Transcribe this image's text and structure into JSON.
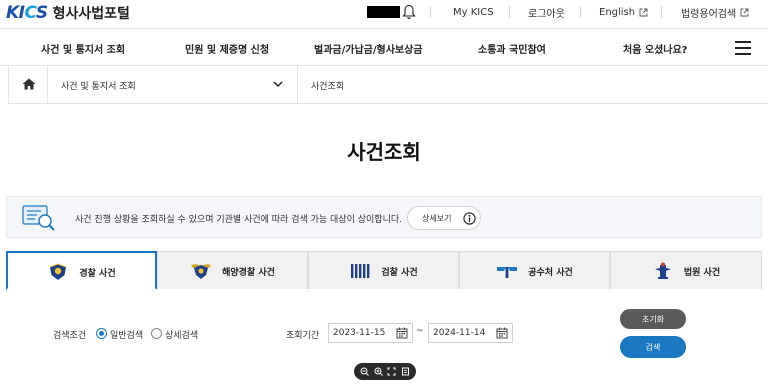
{
  "header": {
    "logo_text": "KICS",
    "site_title": "형사사법포털",
    "utility": [
      {
        "label": "My KICS"
      },
      {
        "label": "로그아웃"
      },
      {
        "label": "English"
      },
      {
        "label": "법령용어검색"
      }
    ]
  },
  "nav": {
    "items": [
      {
        "label": "사건 및 통지서 조회"
      },
      {
        "label": "민원 및 제증명 신청"
      },
      {
        "label": "벌과금/가납금/형사보상금"
      },
      {
        "label": "소통과 국민참여"
      },
      {
        "label": "처음 오셨나요?"
      }
    ],
    "menu_icon": "hamburger-icon"
  },
  "breadcrumb": {
    "home_icon": "home-icon",
    "level1": "사건 및 통지서 조회",
    "level2": "사건조회"
  },
  "page": {
    "title": "사건조회"
  },
  "notice": {
    "text": "사건 진행 상황을 조회하실 수 있으며 기관별 사건에 따라 검색 가능 대상이 상이합니다.",
    "detail_button": "상세보기"
  },
  "tabs": [
    {
      "label": "경찰 사건",
      "icon": "police-emblem-icon",
      "active": true
    },
    {
      "label": "해양경찰 사건",
      "icon": "coast-guard-emblem-icon",
      "active": false
    },
    {
      "label": "검찰 사건",
      "icon": "prosecution-emblem-icon",
      "active": false
    },
    {
      "label": "공수처 사건",
      "icon": "cio-emblem-icon",
      "active": false
    },
    {
      "label": "법원 사건",
      "icon": "court-emblem-icon",
      "active": false
    }
  ],
  "search": {
    "condition_label": "검색조건",
    "options": [
      {
        "label": "일반검색",
        "selected": true
      },
      {
        "label": "상세검색",
        "selected": false
      }
    ],
    "period_label": "조회기간",
    "date_from": "2023-11-15",
    "date_to": "2024-11-14",
    "range_separator": "~",
    "reset_button": "초기화",
    "search_button": "검색"
  },
  "colors": {
    "accent": "#1a78c2",
    "brand_blue": "#1a4fa8",
    "reset_button": "#5a5a5a"
  }
}
